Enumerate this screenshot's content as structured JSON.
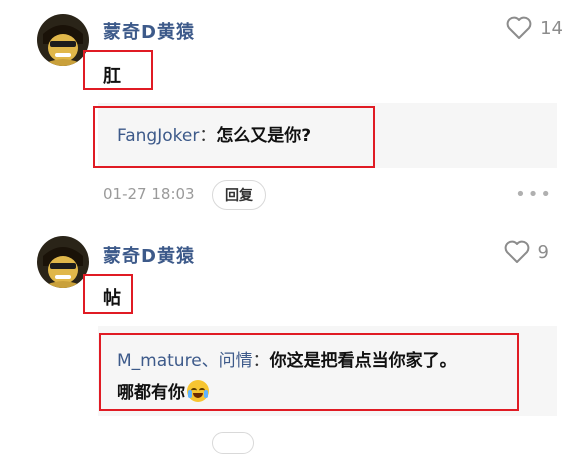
{
  "comments": [
    {
      "username": "蒙奇D黄猿",
      "like_count": "14",
      "text": "肛",
      "reply": {
        "author": "FangJoker",
        "separator": "：",
        "text": "怎么又是你?"
      },
      "timestamp": "01-27 18:03",
      "reply_button": "回复",
      "more": "•••"
    },
    {
      "username": "蒙奇D黄猿",
      "like_count": "9",
      "text": "帖",
      "reply": {
        "author": "M_mature、问情",
        "separator": "：",
        "text_line1": "你这是把看点当你家了。",
        "text_line2": "哪都有你"
      }
    }
  ],
  "colors": {
    "username": "#3d5a8a",
    "highlight_box": "#e01b24",
    "reply_panel": "#f6f6f6"
  },
  "icons": {
    "like": "heart-outline-icon",
    "avatar": "anime-character-avatar",
    "emoji": "laughing-crying-emoji"
  }
}
